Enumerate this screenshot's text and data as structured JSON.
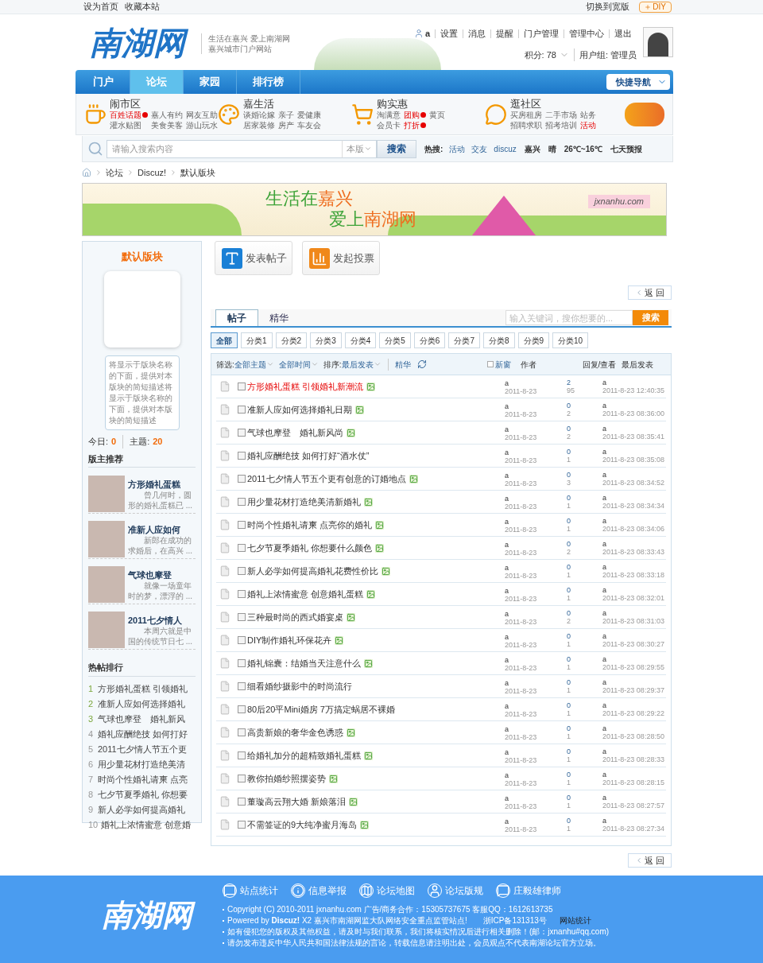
{
  "top_bar": {
    "links": [
      "设为首页",
      "收藏本站"
    ],
    "wide_switch": "切换到宽版",
    "diy": "DIY"
  },
  "header": {
    "logo": "南湖网",
    "slogan": [
      "生活在嘉兴 爱上南湖网",
      "嘉兴城市门户网站"
    ],
    "user": "a",
    "user_links": [
      "设置",
      "消息",
      "提醒",
      "门户管理",
      "管理中心",
      "退出"
    ],
    "points": "积分: 78",
    "group": "用户组: 管理员"
  },
  "nav": {
    "tabs": [
      {
        "label": "门户",
        "selected": false
      },
      {
        "label": "论坛",
        "selected": true
      },
      {
        "label": "家园",
        "selected": false
      },
      {
        "label": "排行榜",
        "selected": false
      }
    ],
    "quick_nav": "快捷导航"
  },
  "categories": [
    {
      "title": "闹市区",
      "kind": "cup",
      "links": [
        {
          "label": "百姓话题",
          "highlight": true,
          "hot": true
        },
        {
          "label": "嘉人有约",
          "highlight": false,
          "hot": false
        },
        {
          "label": "网友互助",
          "highlight": false,
          "hot": false
        },
        {
          "label": "灌水贴图",
          "highlight": false,
          "hot": false
        },
        {
          "label": "美食美客",
          "highlight": false,
          "hot": false
        },
        {
          "label": "游山玩水",
          "highlight": false,
          "hot": false
        }
      ]
    },
    {
      "title": "嘉生活",
      "kind": "palette",
      "links": [
        {
          "label": "谈婚论嫁",
          "highlight": false,
          "hot": false
        },
        {
          "label": "亲子",
          "highlight": false,
          "hot": false
        },
        {
          "label": "爱健康",
          "highlight": false,
          "hot": false
        },
        {
          "label": "居家装修",
          "highlight": false,
          "hot": false
        },
        {
          "label": "房产",
          "highlight": false,
          "hot": false
        },
        {
          "label": "车友会",
          "highlight": false,
          "hot": false
        }
      ]
    },
    {
      "title": "购实惠",
      "kind": "cart",
      "links": [
        {
          "label": "淘满意",
          "highlight": false,
          "hot": false
        },
        {
          "label": "团购",
          "highlight": true,
          "hot": true
        },
        {
          "label": "黄页",
          "highlight": false,
          "hot": false
        },
        {
          "label": "会员卡",
          "highlight": false,
          "hot": false
        },
        {
          "label": "打折",
          "highlight": true,
          "hot": true
        }
      ]
    },
    {
      "title": "逛社区",
      "kind": "chat",
      "links": [
        {
          "label": "买房租房",
          "highlight": false,
          "hot": false
        },
        {
          "label": "二手市场",
          "highlight": false,
          "hot": false
        },
        {
          "label": "站务",
          "highlight": false,
          "hot": false
        },
        {
          "label": "招聘求职",
          "highlight": false,
          "hot": false
        },
        {
          "label": "招考培训",
          "highlight": false,
          "hot": false
        },
        {
          "label": "活动",
          "highlight": true,
          "hot": false
        }
      ]
    }
  ],
  "search": {
    "placeholder": "请输入搜索内容",
    "scope": "本版",
    "button": "搜索",
    "hot_label": "热搜:",
    "hot": [
      "活动",
      "交友",
      "discuz"
    ],
    "weather": [
      "嘉兴",
      "晴",
      "26℃~16℃",
      "七天预报"
    ]
  },
  "breadcrumb": [
    "论坛",
    "Discuz!",
    "默认版块"
  ],
  "banner": {
    "lines": [
      [
        "生活在",
        "嘉兴"
      ],
      [
        "爱上",
        "南湖网"
      ]
    ],
    "site": "jxnanhu.com"
  },
  "sidebar": {
    "forum_name": "默认版块",
    "description": "将显示于版块名称的下面，提供对本版块的简短描述将显示于版块名称的下面，提供对本版块的简短描述",
    "today_label": "今日:",
    "today": "0",
    "topics_label": "主题:",
    "topics": "20",
    "recommend_title": "版主推荐",
    "recommend": [
      {
        "title": "方形婚礼蛋糕",
        "excerpt": "曾几何时，圆形的婚礼蛋糕已 ..."
      },
      {
        "title": "准新人应如何",
        "excerpt": "新郎在成功的求婚后，在高兴 ..."
      },
      {
        "title": "气球也摩登",
        "excerpt": "就像一场童年时的梦，漂浮的 ..."
      },
      {
        "title": "2011七夕情人",
        "excerpt": "本周六就是中国的传统节日七 ..."
      }
    ],
    "hot_title": "热帖排行",
    "hot": [
      {
        "rank": "1",
        "title": "方形婚礼蛋糕 引领婚礼"
      },
      {
        "rank": "2",
        "title": "准新人应如何选择婚礼"
      },
      {
        "rank": "3",
        "title": "气球也摩登　婚礼新风"
      },
      {
        "rank": "4",
        "title": "婚礼应酬绝技 如何打好"
      },
      {
        "rank": "5",
        "title": "2011七夕情人节五个更"
      },
      {
        "rank": "6",
        "title": "用少量花材打造绝美清"
      },
      {
        "rank": "7",
        "title": "时尚个性婚礼请柬 点亮"
      },
      {
        "rank": "8",
        "title": "七夕节夏季婚礼 你想要"
      },
      {
        "rank": "9",
        "title": "新人必学如何提高婚礼"
      },
      {
        "rank": "10",
        "title": "婚礼上浓情蜜意 创意婚"
      }
    ]
  },
  "main": {
    "actions": [
      "发表帖子",
      "发起投票"
    ],
    "back_top": "返 回",
    "back_bottom": "返 回",
    "tabs": [
      {
        "label": "帖子",
        "selected": true
      },
      {
        "label": "精华",
        "selected": false
      }
    ],
    "search": {
      "placeholder": "输入关键词，搜你想要的...",
      "button": "搜索"
    },
    "filters": [
      {
        "label": "全部",
        "selected": true
      },
      {
        "label": "分类1",
        "selected": false
      },
      {
        "label": "分类2",
        "selected": false
      },
      {
        "label": "分类3",
        "selected": false
      },
      {
        "label": "分类4",
        "selected": false
      },
      {
        "label": "分类5",
        "selected": false
      },
      {
        "label": "分类6",
        "selected": false
      },
      {
        "label": "分类7",
        "selected": false
      },
      {
        "label": "分类8",
        "selected": false
      },
      {
        "label": "分类9",
        "selected": false
      },
      {
        "label": "分类10",
        "selected": false
      }
    ],
    "toolbar": {
      "filter_label": "筛选:",
      "topic": "全部主题",
      "time": "全部时间",
      "sort_label": "排序:",
      "sort": "最后发表",
      "digest": "精华",
      "new_window": "新窗",
      "new_window_checked": false,
      "col_author": "作者",
      "col_replies": "回复/查看",
      "col_last": "最后发表"
    },
    "threads": [
      {
        "title": "方形婚礼蛋糕 引领婚礼新潮流",
        "highlighted": true,
        "image": true,
        "checked": false,
        "author": "a",
        "date": "2011-8-23",
        "replies": "2",
        "views": "95",
        "last_author": "a",
        "last_time": "2011-8-23 12:40:35"
      },
      {
        "title": "准新人应如何选择婚礼日期",
        "highlighted": false,
        "image": true,
        "checked": false,
        "author": "a",
        "date": "2011-8-23",
        "replies": "0",
        "views": "2",
        "last_author": "a",
        "last_time": "2011-8-23 08:36:00"
      },
      {
        "title": "气球也摩登　婚礼新风尚",
        "highlighted": false,
        "image": true,
        "checked": false,
        "author": "a",
        "date": "2011-8-23",
        "replies": "0",
        "views": "2",
        "last_author": "a",
        "last_time": "2011-8-23 08:35:41"
      },
      {
        "title": "婚礼应酬绝技 如何打好“酒水仗”",
        "highlighted": false,
        "image": false,
        "checked": false,
        "author": "a",
        "date": "2011-8-23",
        "replies": "0",
        "views": "1",
        "last_author": "a",
        "last_time": "2011-8-23 08:35:08"
      },
      {
        "title": "2011七夕情人节五个更有创意的订婚地点",
        "highlighted": false,
        "image": true,
        "checked": false,
        "author": "a",
        "date": "2011-8-23",
        "replies": "0",
        "views": "3",
        "last_author": "a",
        "last_time": "2011-8-23 08:34:52"
      },
      {
        "title": "用少量花材打造绝美清新婚礼",
        "highlighted": false,
        "image": true,
        "checked": false,
        "author": "a",
        "date": "2011-8-23",
        "replies": "0",
        "views": "1",
        "last_author": "a",
        "last_time": "2011-8-23 08:34:34"
      },
      {
        "title": "时尚个性婚礼请柬 点亮你的婚礼",
        "highlighted": false,
        "image": true,
        "checked": false,
        "author": "a",
        "date": "2011-8-23",
        "replies": "0",
        "views": "1",
        "last_author": "a",
        "last_time": "2011-8-23 08:34:06"
      },
      {
        "title": "七夕节夏季婚礼 你想要什么颜色",
        "highlighted": false,
        "image": true,
        "checked": false,
        "author": "a",
        "date": "2011-8-23",
        "replies": "0",
        "views": "2",
        "last_author": "a",
        "last_time": "2011-8-23 08:33:43"
      },
      {
        "title": "新人必学如何提高婚礼花费性价比",
        "highlighted": false,
        "image": true,
        "checked": false,
        "author": "a",
        "date": "2011-8-23",
        "replies": "0",
        "views": "1",
        "last_author": "a",
        "last_time": "2011-8-23 08:33:18"
      },
      {
        "title": "婚礼上浓情蜜意 创意婚礼蛋糕",
        "highlighted": false,
        "image": true,
        "checked": false,
        "author": "a",
        "date": "2011-8-23",
        "replies": "0",
        "views": "1",
        "last_author": "a",
        "last_time": "2011-8-23 08:32:01"
      },
      {
        "title": "三种最时尚的西式婚宴桌",
        "highlighted": false,
        "image": true,
        "checked": false,
        "author": "a",
        "date": "2011-8-23",
        "replies": "0",
        "views": "2",
        "last_author": "a",
        "last_time": "2011-8-23 08:31:03"
      },
      {
        "title": "DIY制作婚礼环保花卉",
        "highlighted": false,
        "image": true,
        "checked": false,
        "author": "a",
        "date": "2011-8-23",
        "replies": "0",
        "views": "1",
        "last_author": "a",
        "last_time": "2011-8-23 08:30:27"
      },
      {
        "title": "婚礼锦囊：结婚当天注意什么",
        "highlighted": false,
        "image": true,
        "checked": false,
        "author": "a",
        "date": "2011-8-23",
        "replies": "0",
        "views": "1",
        "last_author": "a",
        "last_time": "2011-8-23 08:29:55"
      },
      {
        "title": "细看婚纱摄影中的时尚流行",
        "highlighted": false,
        "image": false,
        "checked": false,
        "author": "a",
        "date": "2011-8-23",
        "replies": "0",
        "views": "1",
        "last_author": "a",
        "last_time": "2011-8-23 08:29:37"
      },
      {
        "title": "80后20平Mini婚房 7万搞定蜗居不裸婚",
        "highlighted": false,
        "image": false,
        "checked": false,
        "author": "a",
        "date": "2011-8-23",
        "replies": "0",
        "views": "1",
        "last_author": "a",
        "last_time": "2011-8-23 08:29:22"
      },
      {
        "title": "高贵新娘的奢华金色诱惑",
        "highlighted": false,
        "image": true,
        "checked": false,
        "author": "a",
        "date": "2011-8-23",
        "replies": "0",
        "views": "1",
        "last_author": "a",
        "last_time": "2011-8-23 08:28:50"
      },
      {
        "title": "给婚礼加分的超精致婚礼蛋糕",
        "highlighted": false,
        "image": true,
        "checked": false,
        "author": "a",
        "date": "2011-8-23",
        "replies": "0",
        "views": "1",
        "last_author": "a",
        "last_time": "2011-8-23 08:28:33"
      },
      {
        "title": "教你拍婚纱照摆姿势",
        "highlighted": false,
        "image": true,
        "checked": false,
        "author": "a",
        "date": "2011-8-23",
        "replies": "0",
        "views": "1",
        "last_author": "a",
        "last_time": "2011-8-23 08:28:15"
      },
      {
        "title": "董璇高云翔大婚 新娘落泪",
        "highlighted": false,
        "image": true,
        "checked": false,
        "author": "a",
        "date": "2011-8-23",
        "replies": "0",
        "views": "1",
        "last_author": "a",
        "last_time": "2011-8-23 08:27:57"
      },
      {
        "title": "不需签证的9大纯净蜜月海岛",
        "highlighted": false,
        "image": true,
        "checked": false,
        "author": "a",
        "date": "2011-8-23",
        "replies": "0",
        "views": "1",
        "last_author": "a",
        "last_time": "2011-8-23 08:27:34"
      }
    ]
  },
  "footer": {
    "logo": "南湖网",
    "links": [
      {
        "label": "站点统计",
        "kind": "chat"
      },
      {
        "label": "信息举报",
        "kind": "info"
      },
      {
        "label": "论坛地图",
        "kind": "map"
      },
      {
        "label": "论坛版规",
        "kind": "user"
      },
      {
        "label": "庄毅雄律师",
        "kind": "chat"
      }
    ],
    "lines": [
      "Copyright (C) 2010-2011 jxnanhu.com  广告/商务合作：15305737675  客服QQ：1612613735",
      "Powered by **Discuz!** X2  嘉兴市南湖网监大队网络安全重点监管站点!　　浙ICP备131313号",
      "如有侵犯您的版权及其他权益，请及时与我们联系，我们将核实情况后进行相关删除！(邮：jxnanhu#qq.com)",
      "请勿发布违反中华人民共和国法律法规的言论，转载信息请注明出处，会员观点不代表南湖论坛官方立场。"
    ],
    "stats_link": "网站统计"
  }
}
